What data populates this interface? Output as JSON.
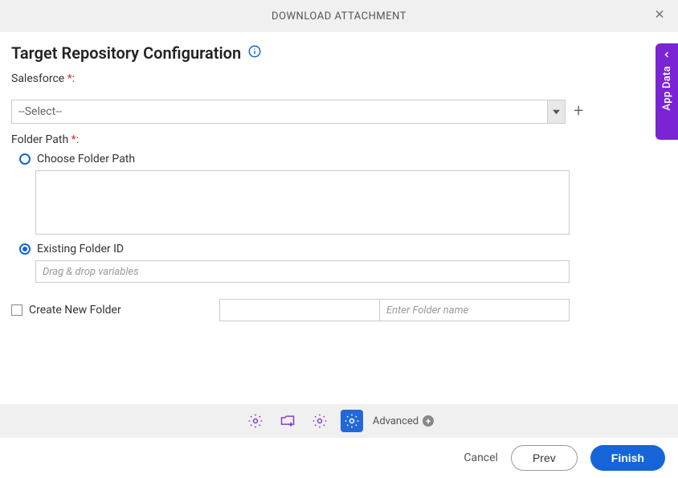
{
  "header": {
    "title": "DOWNLOAD ATTACHMENT"
  },
  "page": {
    "title": "Target Repository Configuration"
  },
  "fields": {
    "salesforce": {
      "label": "Salesforce",
      "required_marker": "*",
      "colon": ":",
      "selected": "--Select--"
    },
    "folderPath": {
      "label": "Folder Path",
      "required_marker": "*",
      "colon": ":",
      "options": {
        "choose": {
          "label": "Choose Folder Path",
          "selected": false
        },
        "existing": {
          "label": "Existing Folder ID",
          "selected": true,
          "placeholder": "Drag & drop variables"
        }
      }
    },
    "createFolder": {
      "label": "Create New Folder",
      "checked": false,
      "name_placeholder": "Enter Folder name"
    }
  },
  "toolbar": {
    "advanced_label": "Advanced"
  },
  "footer": {
    "cancel": "Cancel",
    "prev": "Prev",
    "finish": "Finish"
  },
  "sidebar": {
    "label": "App Data"
  }
}
